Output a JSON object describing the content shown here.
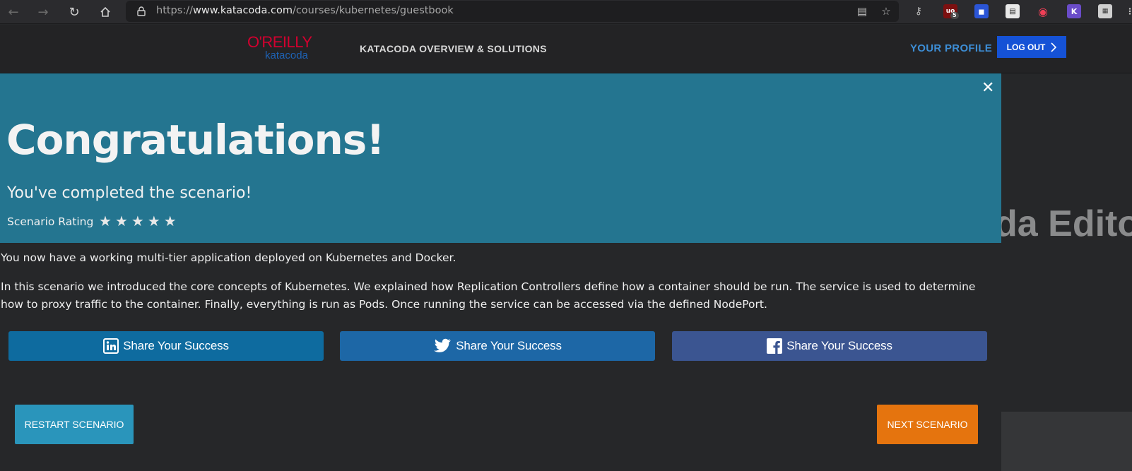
{
  "browser": {
    "url_prefix": "https://",
    "url_domain": "www.katacoda.com",
    "url_path": "/courses/kubernetes/guestbook",
    "extension_badge": "5",
    "ext_letter_k": "K"
  },
  "header": {
    "logo_top": "O'REILLY",
    "logo_bottom": "katacoda",
    "nav_link": "KATACODA OVERVIEW & SOLUTIONS",
    "profile_link": "YOUR PROFILE",
    "logout_label": "LOG OUT"
  },
  "background": {
    "partial_text": "da Editor"
  },
  "modal": {
    "title": "Congratulations!",
    "subtitle": "You've completed the scenario!",
    "rating_label": "Scenario Rating",
    "star_count": 5,
    "paragraph_1": "You now have a working multi-tier application deployed on Kubernetes and Docker.",
    "paragraph_2": "In this scenario we introduced the core concepts of Kubernetes. We explained how Replication Controllers define how a container should be run. The service is used to determine how to proxy traffic to the container. Finally, everything is run as Pods. Once running the service can be accessed via the defined NodePort.",
    "share_buttons": [
      {
        "network": "linkedin",
        "label": "Share Your Success",
        "color": "#0e6b9f"
      },
      {
        "network": "twitter",
        "label": "Share Your Success",
        "color": "#1d67a6"
      },
      {
        "network": "facebook",
        "label": "Share Your Success",
        "color": "#3b5591"
      }
    ],
    "restart_label": "RESTART SCENARIO",
    "next_label": "NEXT SCENARIO"
  },
  "colors": {
    "modal_header": "#247590",
    "restart": "#2a95bb",
    "next": "#e5740e",
    "logout": "#1552d6",
    "profile": "#3d8ed6"
  }
}
